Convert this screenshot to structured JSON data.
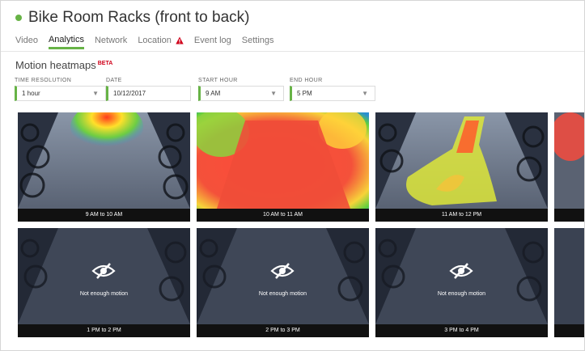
{
  "camera": {
    "title": "Bike Room Racks (front to back)",
    "status_color": "#67b346"
  },
  "tabs": [
    {
      "label": "Video",
      "active": false
    },
    {
      "label": "Analytics",
      "active": true
    },
    {
      "label": "Network",
      "active": false
    },
    {
      "label": "Location",
      "active": false,
      "warning": true,
      "icon": "warning-icon"
    },
    {
      "label": "Event log",
      "active": false
    },
    {
      "label": "Settings",
      "active": false
    }
  ],
  "section": {
    "title": "Motion heatmaps",
    "badge": "BETA"
  },
  "filters": {
    "time_resolution": {
      "label": "TIME RESOLUTION",
      "value": "1 hour"
    },
    "date": {
      "label": "DATE",
      "value": "10/12/2017"
    },
    "start_hour": {
      "label": "START HOUR",
      "value": "9 AM"
    },
    "end_hour": {
      "label": "END HOUR",
      "value": "5 PM"
    }
  },
  "heatmaps": [
    {
      "caption": "9 AM to 10 AM",
      "has_motion": true
    },
    {
      "caption": "10 AM to 11 AM",
      "has_motion": true
    },
    {
      "caption": "11 AM to 12 PM",
      "has_motion": true
    },
    {
      "caption": "",
      "has_motion": true
    },
    {
      "caption": "1 PM to 2 PM",
      "has_motion": false,
      "message": "Not enough motion"
    },
    {
      "caption": "2 PM to 3 PM",
      "has_motion": false,
      "message": "Not enough motion"
    },
    {
      "caption": "3 PM to 4 PM",
      "has_motion": false,
      "message": "Not enough motion"
    },
    {
      "caption": "",
      "has_motion": false
    }
  ],
  "colors": {
    "accent": "#67b346",
    "warning": "#d0021b"
  }
}
